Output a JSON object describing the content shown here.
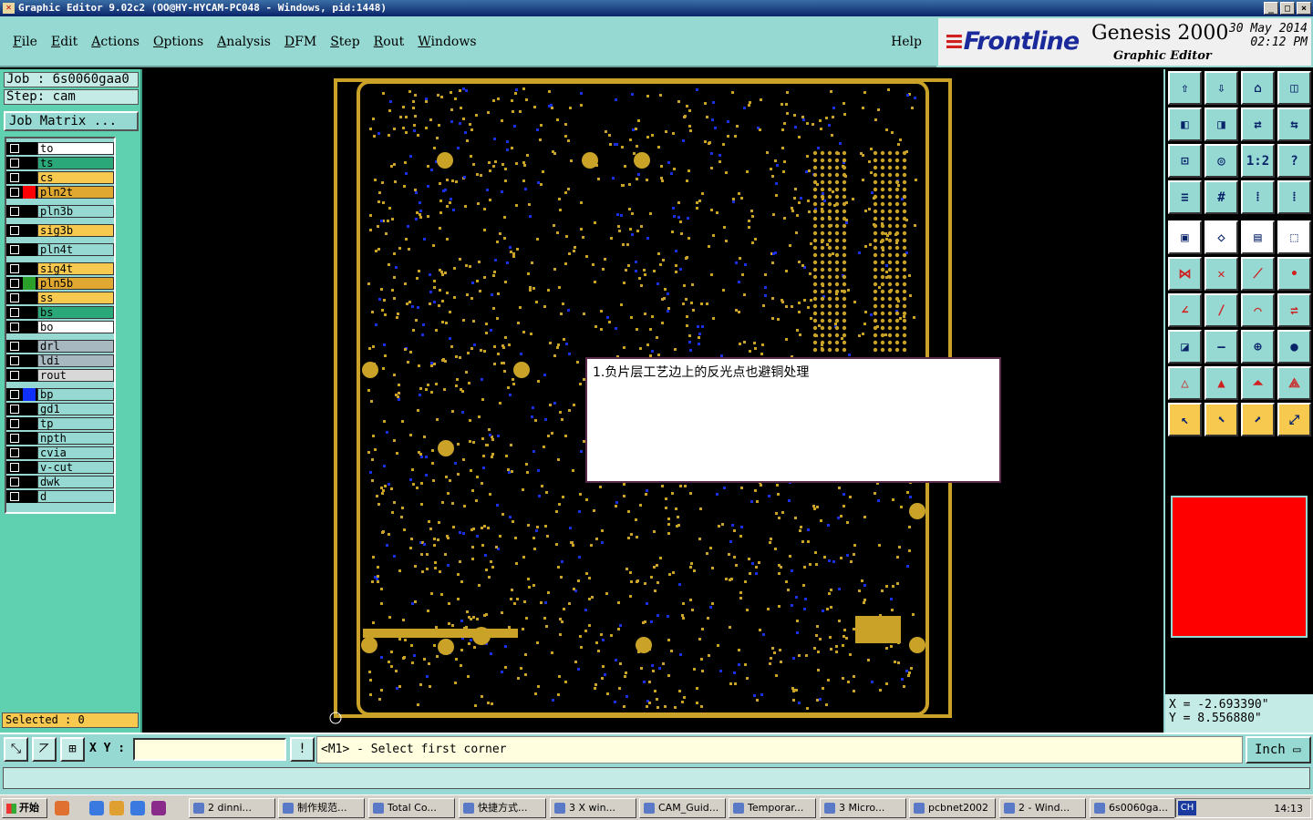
{
  "window": {
    "title": "Graphic Editor 9.02c2 (OO@HY-HYCAM-PC048 - Windows, pid:1448)"
  },
  "menu": {
    "items": [
      "File",
      "Edit",
      "Actions",
      "Options",
      "Analysis",
      "DFM",
      "Step",
      "Rout",
      "Windows"
    ],
    "help": "Help"
  },
  "brand": {
    "logo": "Frontline",
    "product": "Genesis 2000",
    "subtitle": "Graphic Editor",
    "date": "30 May 2014",
    "time": "02:12 PM"
  },
  "job": {
    "job_label": "Job : 6s0060gaa0",
    "step_label": "Step: cam",
    "matrix_button": "Job Matrix ..."
  },
  "layers": [
    {
      "name": "to",
      "color": "#ffffff",
      "swatch": ""
    },
    {
      "name": "ts",
      "color": "#2ba87a",
      "swatch": ""
    },
    {
      "name": "cs",
      "color": "#f7c94e",
      "swatch": ""
    },
    {
      "name": "pln2t",
      "color": "#e0a830",
      "swatch": "#ff0000",
      "active": true
    },
    {
      "name": "pln3b",
      "color": "#95d9d2",
      "swatch": ""
    },
    {
      "name": "sig3b",
      "color": "#f7c94e",
      "swatch": ""
    },
    {
      "name": "pln4t",
      "color": "#95d9d2",
      "swatch": ""
    },
    {
      "name": "sig4t",
      "color": "#f7c94e",
      "swatch": ""
    },
    {
      "name": "pln5b",
      "color": "#e0a830",
      "swatch": "#2aa02a"
    },
    {
      "name": "ss",
      "color": "#f7c94e",
      "swatch": ""
    },
    {
      "name": "bs",
      "color": "#2ba87a",
      "swatch": ""
    },
    {
      "name": "bo",
      "color": "#ffffff",
      "swatch": ""
    },
    {
      "name": "drl",
      "color": "#a8b8c0",
      "swatch": ""
    },
    {
      "name": "ldi",
      "color": "#a8b8c0",
      "swatch": ""
    },
    {
      "name": "rout",
      "color": "#d8d8d8",
      "swatch": ""
    },
    {
      "name": "bp",
      "color": "#95d9d2",
      "swatch": "#1030ff"
    },
    {
      "name": "gd1",
      "color": "#95d9d2",
      "swatch": ""
    },
    {
      "name": "tp",
      "color": "#95d9d2",
      "swatch": ""
    },
    {
      "name": "npth",
      "color": "#95d9d2",
      "swatch": ""
    },
    {
      "name": "cvia",
      "color": "#95d9d2",
      "swatch": ""
    },
    {
      "name": "v-cut",
      "color": "#95d9d2",
      "swatch": ""
    },
    {
      "name": "dwk",
      "color": "#95d9d2",
      "swatch": ""
    },
    {
      "name": "d",
      "color": "#95d9d2",
      "swatch": ""
    }
  ],
  "selected": "Selected : 0",
  "note": "1.负片层工艺边上的反光点也避铜处理",
  "toolbox": {
    "row1": [
      "zoom-home-icon",
      "zoom-in-icon",
      "home-icon",
      "split-view-icon"
    ],
    "row2": [
      "pan-left-icon",
      "pan-right-icon",
      "mirror-icon",
      "swap-icon"
    ],
    "row3": [
      "fit-icon",
      "center-icon",
      "1:2",
      "help-icon"
    ],
    "row4": [
      "tools-icon",
      "grid-icon",
      "snap-a-icon",
      "snap-b-icon"
    ],
    "row5": [
      "frame-icon",
      "shape-icon",
      "ruler-icon",
      "dotbox-icon"
    ],
    "row6": [
      "connect-icon",
      "cross-icon",
      "line-icon",
      "point-icon"
    ],
    "row7": [
      "angle-icon",
      "slash-icon",
      "arc-icon",
      "flip-icon"
    ],
    "row8": [
      "mixed-icon",
      "dash-icon",
      "measure-icon",
      "blob-icon"
    ],
    "row9": [
      "tri-a-icon",
      "tri-b-icon",
      "tri-c-icon",
      "tri-d-icon"
    ],
    "row10": [
      "select-icon",
      "select-box-icon",
      "select-poly-icon",
      "route-icon"
    ]
  },
  "coords": {
    "x": "X = -2.693390\"",
    "y": "Y =  8.556880\""
  },
  "command": {
    "xy_label": "X Y :",
    "xy_value": "",
    "prompt": "<M1> - Select first corner",
    "units": "Inch"
  },
  "taskbar": {
    "start": "开始",
    "tasks": [
      "2 dinni...",
      "制作规范...",
      "Total Co...",
      "快捷方式...",
      "3 X win...",
      "CAM_Guid...",
      "Temporar...",
      "3 Micro...",
      "pcbnet2002",
      "2 - Wind...",
      "6s0060ga..."
    ],
    "clock": "14:13",
    "lang": "CH"
  }
}
